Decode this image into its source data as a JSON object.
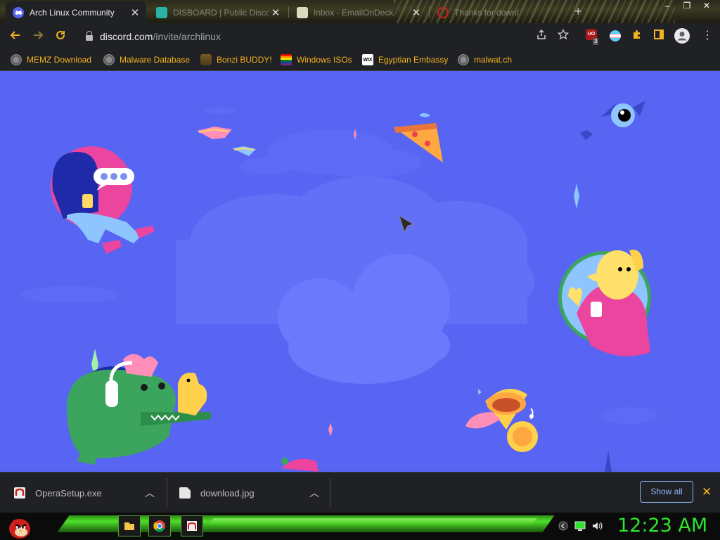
{
  "tabs": [
    {
      "title": "Arch Linux Community",
      "close": "✕"
    },
    {
      "title": "DISBOARD | Public Disco",
      "close": "✕"
    },
    {
      "title": "Inbox - EmailOnDeck",
      "close": "✕"
    },
    {
      "title": "Thanks for downl",
      "close": ""
    }
  ],
  "new_tab": "+",
  "window_controls": {
    "minimize": "–",
    "maximize": "❐",
    "close": "✕"
  },
  "address_bar": {
    "host": "discord.com",
    "path": "/invite/archlinux"
  },
  "extensions": {
    "ublock_badge": "3",
    "ublock_label": "UO"
  },
  "bookmarks": [
    {
      "label": "MEMZ Download",
      "icon": "globe-icon"
    },
    {
      "label": "Malware Database",
      "icon": "globe-icon"
    },
    {
      "label": "Bonzi BUDDY!",
      "icon": "bonzi-icon"
    },
    {
      "label": "Windows ISOs",
      "icon": "rainbow-flag-icon"
    },
    {
      "label": "Egyptian Embassy",
      "icon": "wix-icon"
    },
    {
      "label": "malwat.ch",
      "icon": "globe-icon"
    }
  ],
  "wix_text": "WIX",
  "downloads": {
    "items": [
      {
        "name": "OperaSetup.exe"
      },
      {
        "name": "download.jpg"
      }
    ],
    "show_all": "Show all",
    "close": "✕"
  },
  "taskbar": {
    "clock": "12:23 AM"
  },
  "colors": {
    "page_background": "#5865f2",
    "bookmark_text": "#f2b21d",
    "clock": "#2de42d"
  }
}
